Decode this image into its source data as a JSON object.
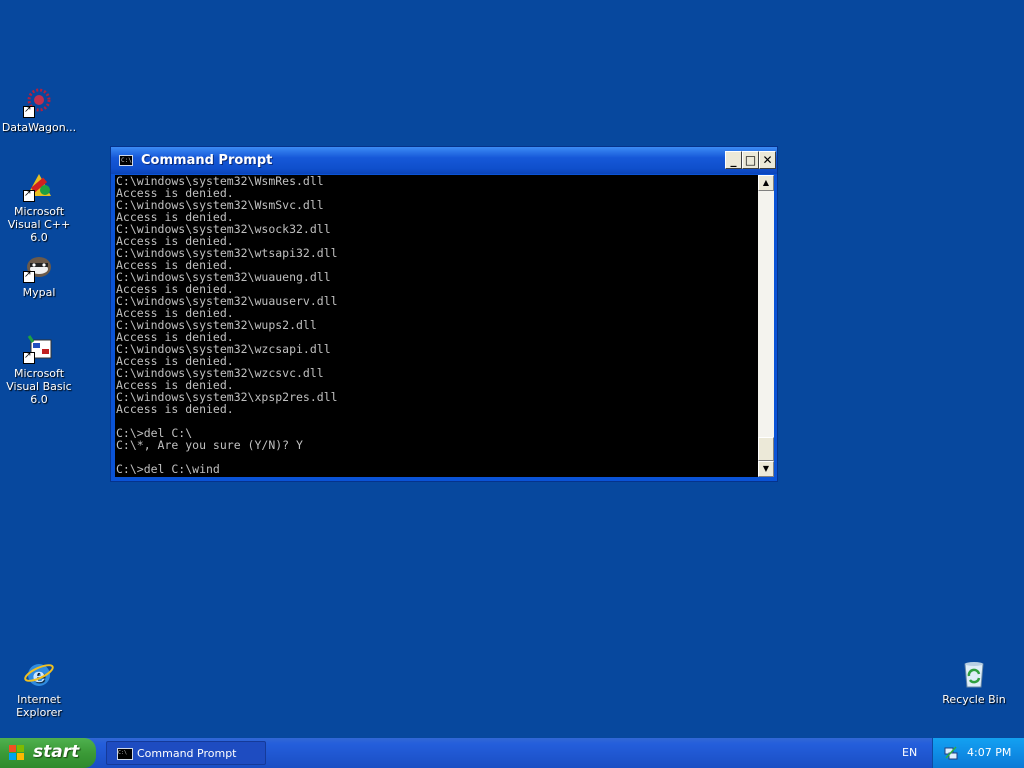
{
  "desktop": {
    "icons": [
      {
        "label": "DataWagon...",
        "icon": "datawagon-icon"
      },
      {
        "label": "Microsoft Visual C++ 6.0",
        "icon": "visual-cpp-icon"
      },
      {
        "label": "Mypal",
        "icon": "mypal-icon"
      },
      {
        "label": "Microsoft Visual Basic 6.0",
        "icon": "visual-basic-icon"
      },
      {
        "label": "Internet Explorer",
        "icon": "internet-explorer-icon"
      },
      {
        "label": "Recycle Bin",
        "icon": "recycle-bin-icon"
      }
    ]
  },
  "window": {
    "title": "Command Prompt",
    "icon_text": "C:\\",
    "minimize": "_",
    "maximize": "□",
    "close": "✕",
    "console_text": "C:\\windows\\system32\\WsmRes.dll\nAccess is denied.\nC:\\windows\\system32\\WsmSvc.dll\nAccess is denied.\nC:\\windows\\system32\\wsock32.dll\nAccess is denied.\nC:\\windows\\system32\\wtsapi32.dll\nAccess is denied.\nC:\\windows\\system32\\wuaueng.dll\nAccess is denied.\nC:\\windows\\system32\\wuauserv.dll\nAccess is denied.\nC:\\windows\\system32\\wups2.dll\nAccess is denied.\nC:\\windows\\system32\\wzcsapi.dll\nAccess is denied.\nC:\\windows\\system32\\wzcsvc.dll\nAccess is denied.\nC:\\windows\\system32\\xpsp2res.dll\nAccess is denied.\n\nC:\\>del C:\\\nC:\\*, Are you sure (Y/N)? Y\n\nC:\\>del C:\\wind",
    "scroll_up": "▲",
    "scroll_down": "▼"
  },
  "taskbar": {
    "start_label": "start",
    "task_label": "Command Prompt",
    "language": "EN",
    "clock": "4:07 PM"
  },
  "colors": {
    "desktop": "#07489e",
    "console_bg": "#000000",
    "console_text": "#c0c0c0",
    "titlebar": "#0f4fcc",
    "start_button": "#3b9a37"
  }
}
